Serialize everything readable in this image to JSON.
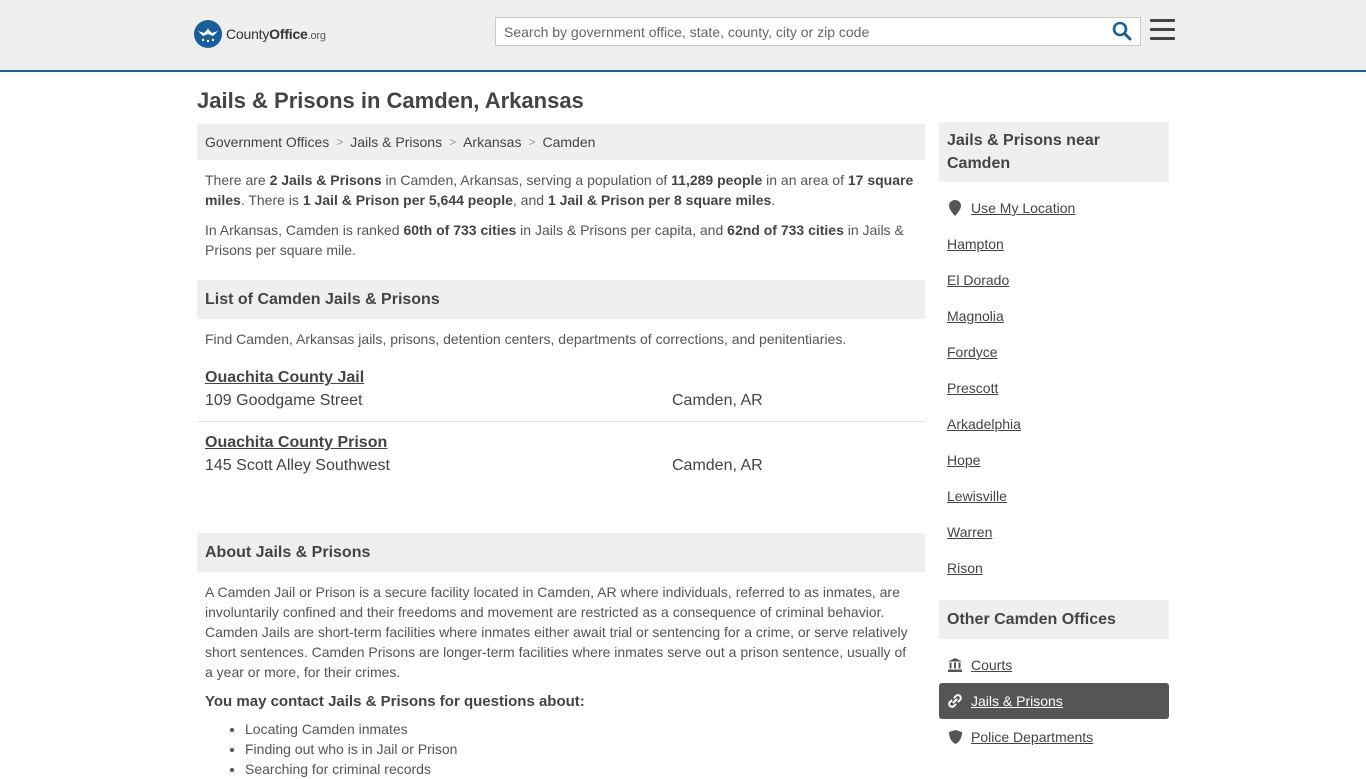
{
  "header": {
    "logo": {
      "county": "County",
      "office": "Office",
      "org": ".org"
    },
    "search_placeholder": "Search by government office, state, county, city or zip code",
    "brand_color": "#1a5e99"
  },
  "page_title": "Jails & Prisons in Camden, Arkansas",
  "breadcrumb": [
    {
      "label": "Government Offices"
    },
    {
      "label": "Jails & Prisons"
    },
    {
      "label": "Arkansas"
    },
    {
      "label": "Camden"
    }
  ],
  "intro": {
    "p1": {
      "t1": "There are ",
      "b1": "2 Jails & Prisons",
      "t2": " in Camden, Arkansas, serving a population of ",
      "b2": "11,289 people",
      "t3": " in an area of ",
      "b3": "17 square miles",
      "t4": ". There is ",
      "b4": "1 Jail & Prison per 5,644 people",
      "t5": ", and ",
      "b5": "1 Jail & Prison per 8 square miles",
      "t6": "."
    },
    "p2": {
      "t1": "In Arkansas, Camden is ranked ",
      "b1": "60th of 733 cities",
      "t2": " in Jails & Prisons per capita, and ",
      "b2": "62nd of 733 cities",
      "t3": " in Jails & Prisons per square mile."
    }
  },
  "list_section": {
    "title": "List of Camden Jails & Prisons",
    "description": "Find Camden, Arkansas jails, prisons, detention centers, departments of corrections, and penitentiaries.",
    "items": [
      {
        "name": "Ouachita County Jail",
        "street": "109 Goodgame Street",
        "city": "Camden, AR"
      },
      {
        "name": "Ouachita County Prison",
        "street": "145 Scott Alley Southwest",
        "city": "Camden, AR"
      }
    ]
  },
  "about_section": {
    "title": "About Jails & Prisons",
    "text": "A Camden Jail or Prison is a secure facility located in Camden, AR where individuals, referred to as inmates, are involuntarily confined and their freedoms and movement are restricted as a consequence of criminal behavior. Camden Jails are short-term facilities where inmates either await trial or sentencing for a crime, or serve relatively short sentences. Camden Prisons are longer-term facilities where inmates serve out a prison sentence, usually of a year or more, for their crimes.",
    "contact_title": "You may contact Jails & Prisons for questions about:",
    "contact_items": [
      "Locating Camden inmates",
      "Finding out who is in Jail or Prison",
      "Searching for criminal records"
    ]
  },
  "sidebar": {
    "nearby_title": "Jails & Prisons near Camden",
    "use_location": "Use My Location",
    "nearby": [
      "Hampton",
      "El Dorado",
      "Magnolia",
      "Fordyce",
      "Prescott",
      "Arkadelphia",
      "Hope",
      "Lewisville",
      "Warren",
      "Rison"
    ],
    "other_title": "Other Camden Offices",
    "offices": [
      {
        "label": "Courts",
        "icon": "courthouse-icon",
        "active": false
      },
      {
        "label": "Jails & Prisons",
        "icon": "link-icon",
        "active": true
      },
      {
        "label": "Police Departments",
        "icon": "shield-icon",
        "active": false
      }
    ],
    "active_color": "#555555"
  }
}
